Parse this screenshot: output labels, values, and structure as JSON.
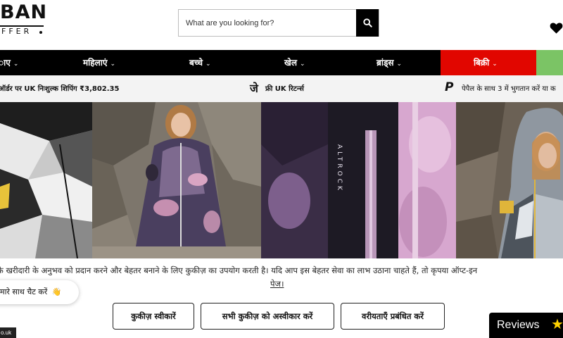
{
  "brand": {
    "logo_main": "BAN",
    "logo_sub": "FFER"
  },
  "search": {
    "placeholder": "What are you looking for?"
  },
  "nav": {
    "items": [
      {
        "label": "ाए"
      },
      {
        "label": "महिलाएं"
      },
      {
        "label": "बच्चे"
      },
      {
        "label": "खेल"
      },
      {
        "label": "ब्रांड्स"
      },
      {
        "label": "बिक्री"
      }
    ],
    "chevron": "⌄",
    "sale_color": "#e10600",
    "accent_color": "#7bc465"
  },
  "usp": {
    "items": [
      {
        "text": "ऑर्डर पर UK निःशुल्क शिपिंग ₹3,802.35"
      },
      {
        "icon_text": "जे",
        "text": "फ्री UK रिटर्न्स"
      },
      {
        "icon_text": "P",
        "text": "पेपैल के साथ 3 में भुगतान करें या क"
      }
    ]
  },
  "cookie": {
    "text": "के खरीदारी के अनुभव को प्रदान करने और बेहतर बनाने के लिए कुकीज़ का उपयोग करती है। यदि आप इस बेहतर सेवा का लाभ उठाना चाहते हैं, तो कृपया ऑप्ट-इन",
    "link": "पेज।",
    "accept": "कुकीज़ स्वीकारें",
    "reject": "सभी कुकीज़ को अस्वीकार करें",
    "manage": "वरीयताएँ प्रबंधित करें"
  },
  "chat": {
    "label": "मारे साथ चैट करें",
    "emoji": "👋"
  },
  "url_tag": "o.uk",
  "reviews": {
    "label": "Reviews",
    "star": "★"
  },
  "photos": {
    "garment_label": "ALTROCK"
  }
}
